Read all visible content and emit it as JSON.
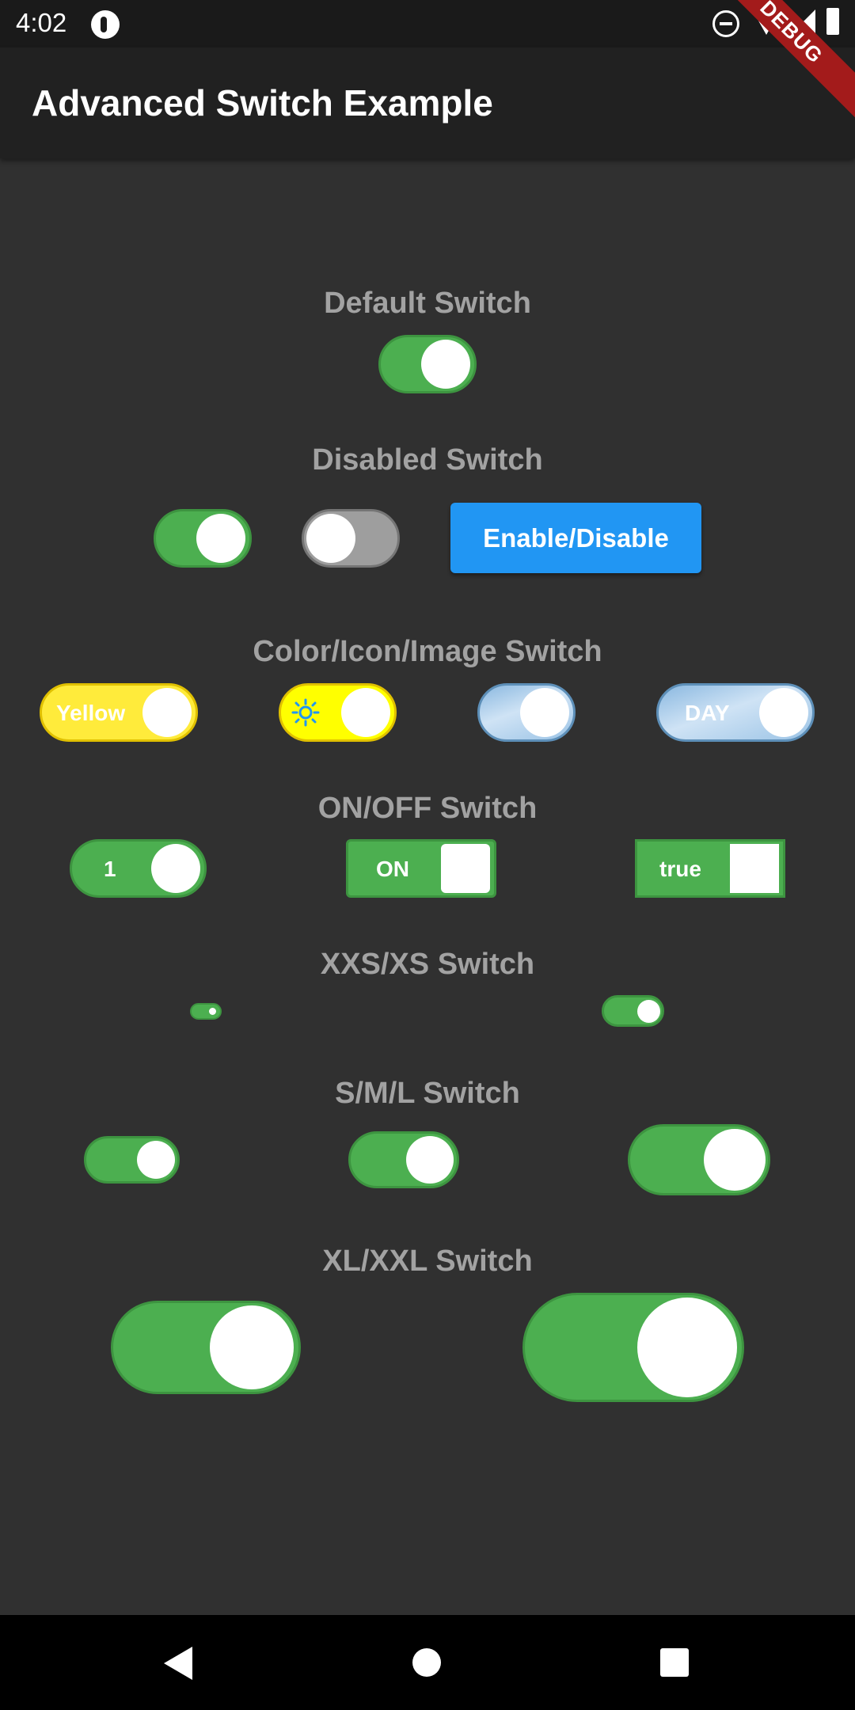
{
  "status_bar": {
    "time": "4:02"
  },
  "app_bar": {
    "title": "Advanced Switch Example",
    "debug_banner": "DEBUG"
  },
  "colors": {
    "background": "#303030",
    "app_bar": "#212121",
    "switch_on": "#4caf50",
    "switch_off": "#9e9e9e",
    "yellow": "#ffeb3b",
    "button": "#2196f3",
    "section_title": "#a2a2a2"
  },
  "sections": {
    "default": {
      "title": "Default Switch",
      "switch_on": true
    },
    "disabled": {
      "title": "Disabled Switch",
      "switch_a_on": true,
      "switch_b_on": false,
      "button_label": "Enable/Disable"
    },
    "color_icon_image": {
      "title": "Color/Icon/Image Switch",
      "yellow_label": "Yellow",
      "icon_name": "sun-icon",
      "image_label": "DAY"
    },
    "on_off": {
      "title": "ON/OFF Switch",
      "labels": [
        "1",
        "ON",
        "true"
      ]
    },
    "xxs_xs": {
      "title": "XXS/XS Switch"
    },
    "sml": {
      "title": "S/M/L Switch"
    },
    "xl_xxl": {
      "title": "XL/XXL Switch"
    }
  },
  "nav_bar": {
    "icons": [
      "back-icon",
      "home-icon",
      "recents-icon"
    ]
  }
}
